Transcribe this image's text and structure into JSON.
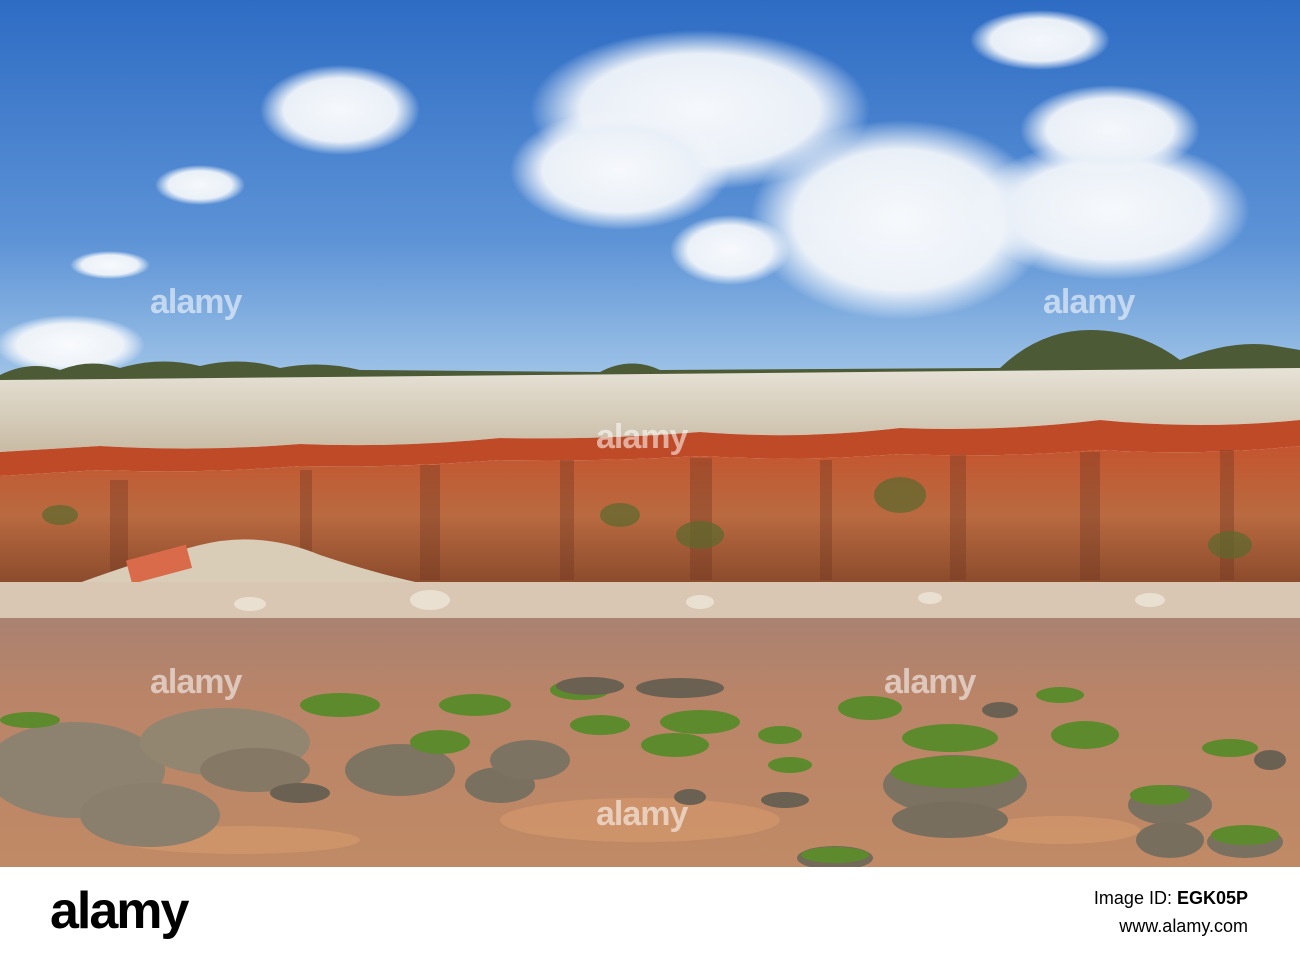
{
  "photo": {
    "subject": "striped-cliff-beach",
    "colors": {
      "sky_top": "#2f6fc6",
      "sky_bottom": "#a9cbea",
      "chalk": "#ddd6c6",
      "red_band": "#b84a2a",
      "carrstone": "#b8683f",
      "shingle": "#d9c7b3",
      "sand": "#b98468",
      "rock": "#8d8270",
      "weed": "#5d8a2d"
    }
  },
  "watermarks": [
    "alamy",
    "alamy",
    "alamy",
    "alamy",
    "alamy",
    "alamy"
  ],
  "footer": {
    "logo": "alamy",
    "image_id_label": "Image ID: ",
    "image_id": "EGK05P",
    "url": "www.alamy.com"
  }
}
